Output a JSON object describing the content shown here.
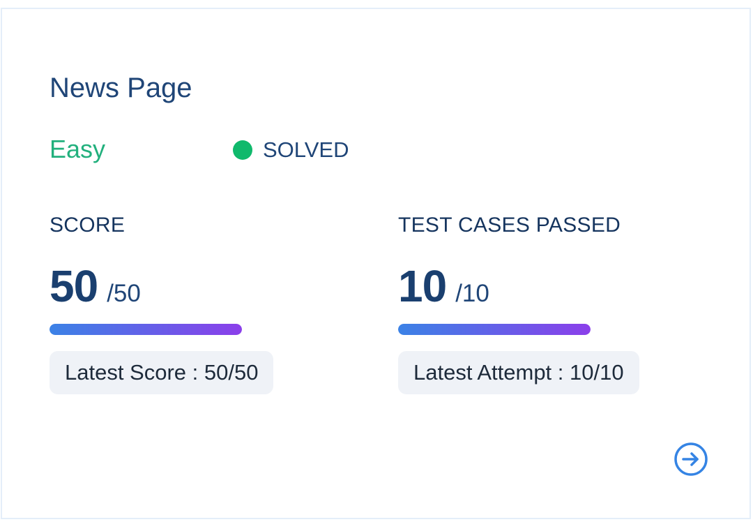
{
  "card": {
    "title": "News Page",
    "difficulty": "Easy",
    "status": {
      "label": "SOLVED",
      "dot_color": "#10b96c"
    },
    "score": {
      "label": "SCORE",
      "value": "50",
      "total": "/50",
      "progress_fraction": 1.0,
      "chip": "Latest Score : 50/50"
    },
    "test_cases": {
      "label": "TEST CASES PASSED",
      "value": "10",
      "total": "/10",
      "progress_fraction": 1.0,
      "chip": "Latest Attempt : 10/10"
    },
    "open_icon": "arrow-right-circle-icon"
  },
  "colors": {
    "title": "#1f4577",
    "difficulty_easy": "#22b07d",
    "progress_start": "#3b82e6",
    "progress_end": "#8b3fea",
    "arrow_icon": "#3584e4",
    "card_border": "#e4eef9",
    "chip_background": "#eff2f7"
  }
}
